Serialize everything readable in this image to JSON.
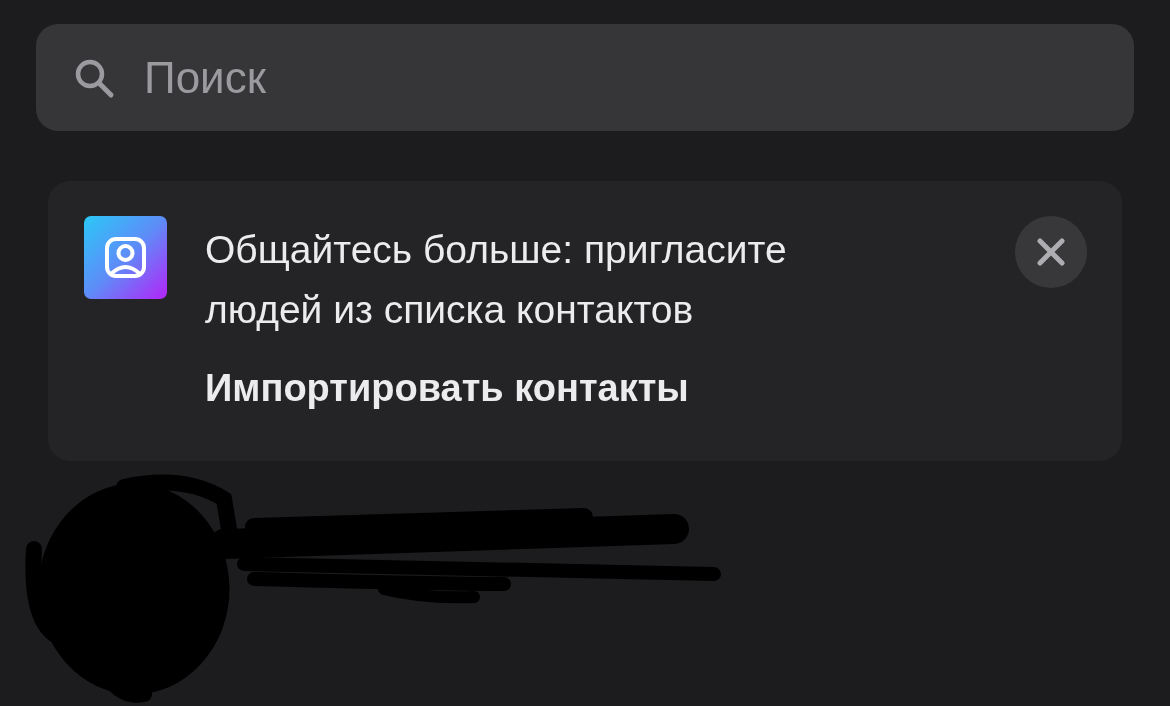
{
  "search": {
    "placeholder": "Поиск"
  },
  "banner": {
    "message": "Общайтесь больше: пригласите людей из списка контактов",
    "action": "Импортировать контакты"
  }
}
